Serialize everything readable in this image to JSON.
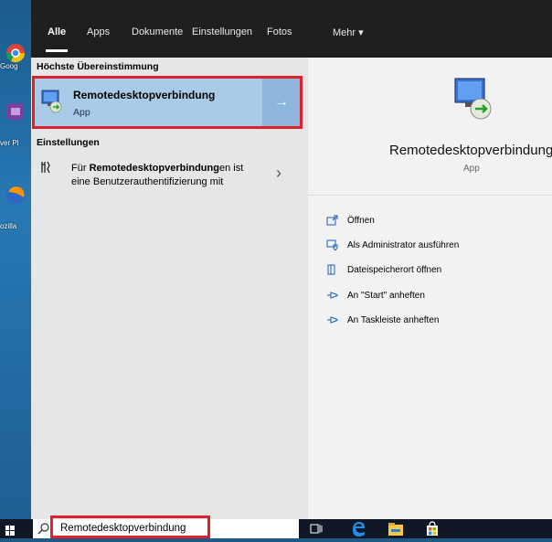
{
  "desktop": {
    "icons": [
      {
        "label": "Goog",
        "icon": "chrome-icon",
        "color": "#4aa24a"
      },
      {
        "label": "ver Pl",
        "icon": "app-icon",
        "color": "#7b3fa0"
      },
      {
        "label": "ozilla",
        "icon": "firefox-icon",
        "color": "#2d66c4"
      }
    ]
  },
  "tabs": [
    {
      "label": "Alle",
      "active": true
    },
    {
      "label": "Apps"
    },
    {
      "label": "Dokumente"
    },
    {
      "label": "Einstellungen"
    },
    {
      "label": "Fotos"
    },
    {
      "label": "Mehr ▾"
    }
  ],
  "best_match": {
    "heading": "Höchste Übereinstimmung",
    "title": "Remotedesktopverbindung",
    "subtitle": "App",
    "icon": "remote-desktop-icon",
    "arrow": "→"
  },
  "settings": {
    "heading": "Einstellungen",
    "item": {
      "prefix": "Für ",
      "bold": "Remotedesktopverbindung",
      "suffix": "en ist",
      "line2": "eine Benutzerauthentifizierung mit",
      "icon": "settings-tools-icon",
      "chevron": "›"
    }
  },
  "detail": {
    "title": "Remotedesktopverbindung",
    "subtitle": "App",
    "icon": "remote-desktop-icon",
    "actions": [
      {
        "label": "Öffnen",
        "icon": "open-icon"
      },
      {
        "label": "Als Administrator ausführen",
        "icon": "admin-shield-icon"
      },
      {
        "label": "Dateispeicherort öffnen",
        "icon": "file-location-icon"
      },
      {
        "label": "An \"Start\" anheften",
        "icon": "pin-icon"
      },
      {
        "label": "An Taskleiste anheften",
        "icon": "pin-icon"
      }
    ]
  },
  "search": {
    "value": "Remotedesktopverbindung",
    "icon": "search-icon"
  },
  "taskbar": {
    "icons": [
      "start-icon",
      "task-view-icon",
      "edge-icon",
      "file-explorer-icon",
      "store-icon"
    ]
  },
  "colors": {
    "accent_selection": "#a9cbe8",
    "highlight_frame": "#e0202c",
    "panel_dark": "#1f1f1f"
  }
}
